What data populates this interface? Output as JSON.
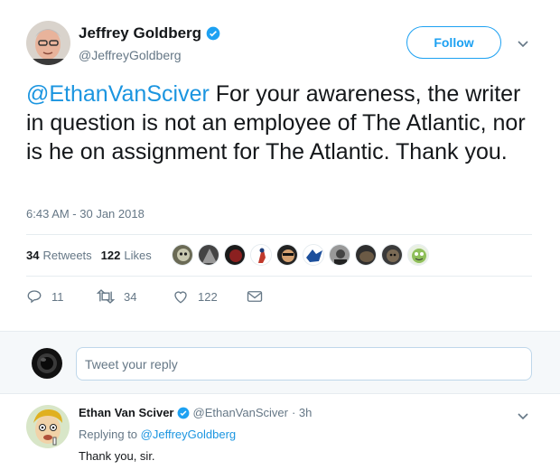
{
  "tweet": {
    "author_name": "Jeffrey Goldberg",
    "author_handle": "@JeffreyGoldberg",
    "follow_label": "Follow",
    "mention": "@EthanVanSciver",
    "body": " For your awareness, the writer in question is not an employee of The Atlantic, nor is he on assignment for The Atlantic. Thank you.",
    "timestamp": "6:43 AM - 30 Jan 2018",
    "retweets_count": "34",
    "retweets_label": "Retweets",
    "likes_count": "122",
    "likes_label": "Likes",
    "liker_count_shown": 10
  },
  "actions": {
    "reply_count": "11",
    "retweet_count": "34",
    "like_count": "122"
  },
  "reply_box": {
    "placeholder": "Tweet your reply"
  },
  "reply": {
    "name": "Ethan Van Sciver",
    "handle": "@EthanVanSciver",
    "time": "· 3h",
    "replying_prefix": "Replying to",
    "replying_to": "@JeffreyGoldberg",
    "text": "Thank you, sir."
  },
  "colors": {
    "accent": "#1da1f2",
    "link": "#1b95e0",
    "muted": "#657786"
  }
}
